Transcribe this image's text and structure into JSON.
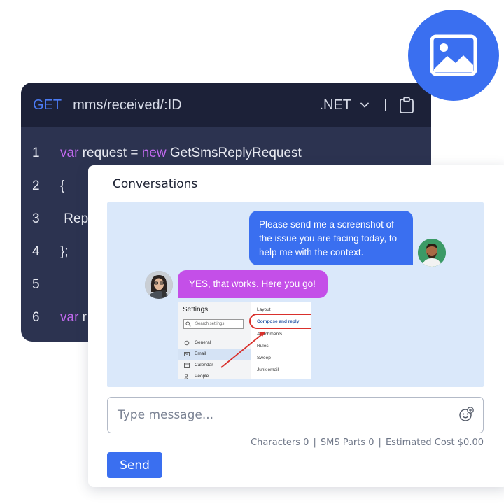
{
  "code": {
    "method": "GET",
    "endpoint": "mms/received/:ID",
    "language": ".NET",
    "lines": [
      {
        "num": "1",
        "kw": "var",
        "text": " request = ",
        "kw2": "new",
        "text2": " GetSmsReplyRequest"
      },
      {
        "num": "2",
        "text": "{"
      },
      {
        "num": "3",
        "text": " Rep"
      },
      {
        "num": "4",
        "text": "};"
      },
      {
        "num": "5",
        "text": ""
      },
      {
        "num": "6",
        "kw": "var",
        "text": " r"
      }
    ]
  },
  "conversations": {
    "title": "Conversations",
    "outgoing_message": "Please send me a screenshot of the issue you are facing today, to help me with the context.",
    "incoming_message": "YES, that works. Here you go!",
    "screenshot": {
      "title": "Settings",
      "search_placeholder": "Search settings",
      "nav": [
        "General",
        "Email",
        "Calendar",
        "People"
      ],
      "right": [
        "Layout",
        "Compose and reply",
        "Attachments",
        "Rules",
        "Sweep",
        "Junk email"
      ]
    },
    "input_placeholder": "Type message...",
    "stats": {
      "characters": "Characters 0",
      "sms_parts": "SMS Parts 0",
      "cost": "Estimated Cost $0.00"
    },
    "send_label": "Send"
  },
  "colors": {
    "accent": "#3a6ff0",
    "incoming_bubble": "#c44fe8",
    "code_bg": "#2c3350",
    "code_header_bg": "#1c2138",
    "keyword": "#c36af0"
  },
  "icons": [
    "image-icon",
    "chevron-down-icon",
    "clipboard-icon",
    "emoji-add-icon"
  ]
}
